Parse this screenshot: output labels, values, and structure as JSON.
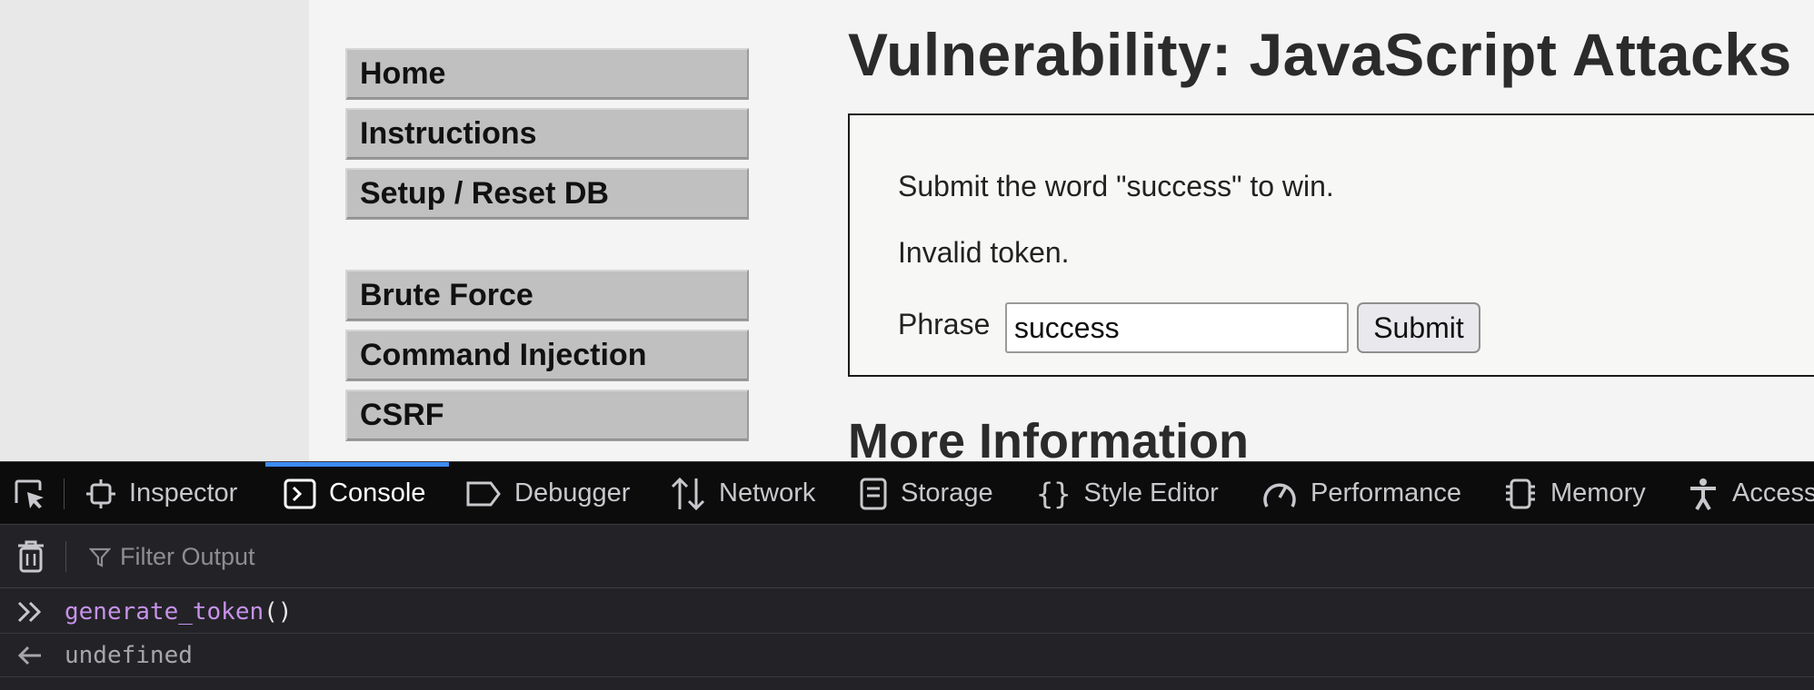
{
  "page": {
    "menu_group_1": [
      "Home",
      "Instructions",
      "Setup / Reset DB"
    ],
    "menu_group_2": [
      "Brute Force",
      "Command Injection",
      "CSRF"
    ],
    "title": "Vulnerability: JavaScript Attacks",
    "instruction": "Submit the word \"success\" to win.",
    "status": "Invalid token.",
    "phrase_label": "Phrase",
    "phrase_value": "success",
    "submit_label": "Submit",
    "more_info_heading": "More Information"
  },
  "devtools": {
    "tabs": [
      "Inspector",
      "Console",
      "Debugger",
      "Network",
      "Storage",
      "Style Editor",
      "Performance",
      "Memory",
      "Access"
    ],
    "active_tab": "Console",
    "filter_placeholder": "Filter Output",
    "console": {
      "input_fn": "generate_token",
      "input_parens": "()",
      "output": "undefined"
    },
    "colors": {
      "toolbar": "#0c0c0d",
      "panel": "#232327",
      "active_indicator": "#3f8cf3",
      "function": "#c792ea"
    }
  }
}
